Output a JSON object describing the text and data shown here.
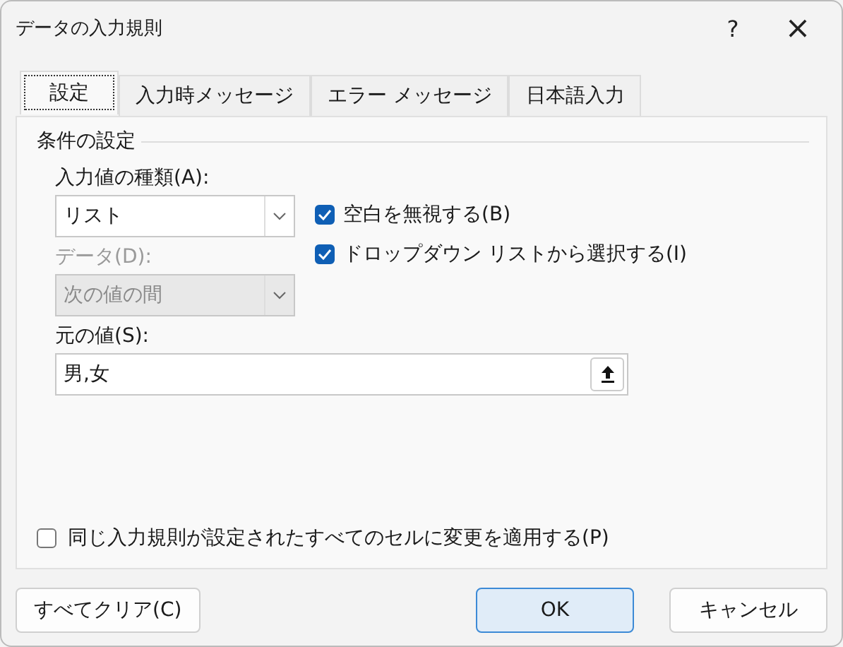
{
  "window": {
    "title": "データの入力規則",
    "help": "?",
    "close": "×"
  },
  "tabs": [
    {
      "label": "設定",
      "selected": true
    },
    {
      "label": "入力時メッセージ",
      "selected": false
    },
    {
      "label": "エラー メッセージ",
      "selected": false
    },
    {
      "label": "日本語入力",
      "selected": false
    }
  ],
  "group": {
    "title": "条件の設定"
  },
  "allow": {
    "label": "入力値の種類(A):",
    "value": "リスト",
    "disabled": false
  },
  "data": {
    "label": "データ(D):",
    "value": "次の値の間",
    "disabled": true
  },
  "checkboxes": [
    {
      "label": "空白を無視する(B)",
      "checked": true
    },
    {
      "label": "ドロップダウン リストから選択する(I)",
      "checked": true
    }
  ],
  "source": {
    "label": "元の値(S):",
    "value": "男,女"
  },
  "apply_all": {
    "label": "同じ入力規則が設定されたすべてのセルに変更を適用する(P)",
    "checked": false
  },
  "buttons": {
    "clear": "すべてクリア(C)",
    "ok": "OK",
    "cancel": "キャンセル"
  }
}
